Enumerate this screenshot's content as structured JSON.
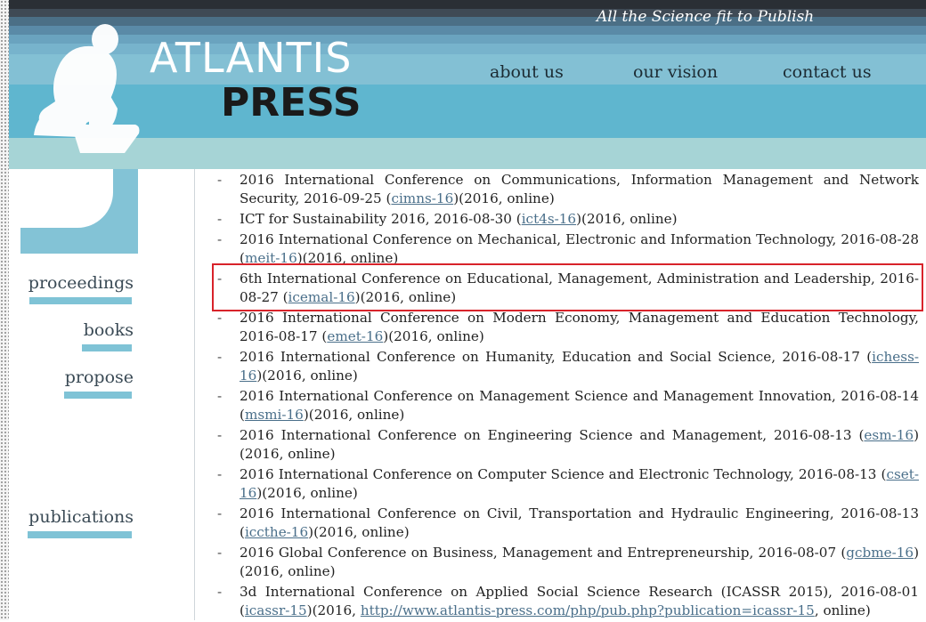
{
  "header": {
    "tagline": "All the Science fit to Publish",
    "logo_line1": "ATLANTIS",
    "logo_line2": "PRESS",
    "nav": [
      "about us",
      "our vision",
      "contact us"
    ]
  },
  "sidebar": {
    "items": [
      "proceedings",
      "books",
      "propose",
      "publications"
    ]
  },
  "conferences": [
    {
      "text": "2016 International Conference on Communications, Information Management and Network Security, 2016-09-25 (",
      "code": "cimns-16",
      "tail": ")(2016, online)"
    },
    {
      "text": "ICT for Sustainability 2016, 2016-08-30 (",
      "code": "ict4s-16",
      "tail": ")(2016, online)"
    },
    {
      "text": "2016 International Conference on Mechanical, Electronic and Information Technology, 2016-08-28 (",
      "code": "meit-16",
      "tail": ")(2016, online)"
    },
    {
      "text": "6th International Conference on Educational, Management, Administration and Leadership, 2016-08-27 (",
      "code": "icemal-16",
      "tail": ")(2016, online)"
    },
    {
      "text": "2016 International Conference on Modern Economy, Management and Education Technology, 2016-08-17 (",
      "code": "emet-16",
      "tail": ")(2016, online)"
    },
    {
      "text": "2016 International Conference on Humanity, Education and Social Science, 2016-08-17 (",
      "code": "ichess-16",
      "tail": ")(2016, online)"
    },
    {
      "text": "2016 International Conference on Management Science and Management Innovation, 2016-08-14 (",
      "code": "msmi-16",
      "tail": ")(2016, online)"
    },
    {
      "text": "2016 International Conference on Engineering Science and Management, 2016-08-13 (",
      "code": "esm-16",
      "tail": ")(2016, online)"
    },
    {
      "text": "2016 International Conference on Computer Science and Electronic Technology, 2016-08-13 (",
      "code": "cset-16",
      "tail": ")(2016, online)"
    },
    {
      "text": "2016 International Conference on Civil, Transportation and Hydraulic Engineering, 2016-08-13 (",
      "code": "iccthe-16",
      "tail": ")(2016, online)"
    },
    {
      "text": "2016 Global Conference on Business, Management and Entrepreneurship, 2016-08-07 (",
      "code": "gcbme-16",
      "tail": ")(2016, online)"
    },
    {
      "text": "3d International Conference on Applied Social Science Research (ICASSR 2015), 2016-08-01 (",
      "code": "icassr-15",
      "tail": ")(2016, ",
      "url": "http://www.atlantis-press.com/php/pub.php?publication=icassr-15",
      "tail2": ", online)"
    }
  ]
}
